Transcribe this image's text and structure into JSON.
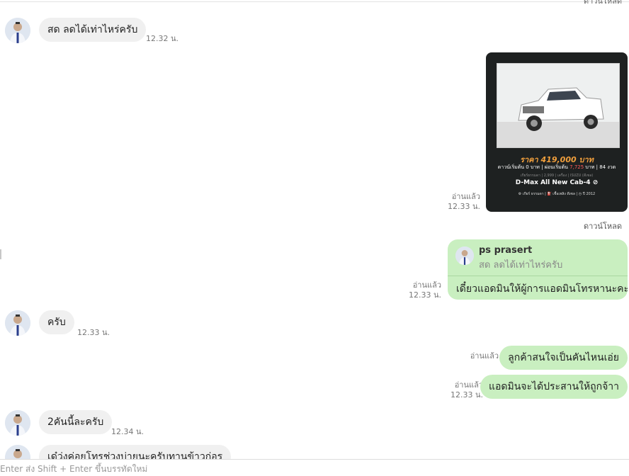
{
  "chat": {
    "download_top": "ดาวน์โหลด",
    "download_label": "ดาวน์โหลด",
    "messages": {
      "m1": {
        "text": "สด ลดได้เท่าไหร่ครับ",
        "time": "12.32 น."
      },
      "img": {
        "read": "อ่านแล้ว",
        "time": "12.33 น."
      },
      "reply": {
        "quoted_name": "ps prasert",
        "quoted_text": "สด ลดได้เท่าไหร่ครับ",
        "text": "เดี๋ยวแอดมินให้ผู้การแอดมินโทรหานะคะ",
        "read": "อ่านแล้ว",
        "time": "12.33 น."
      },
      "m3": {
        "text": "ครับ",
        "time": "12.33 น."
      },
      "m4": {
        "text": "ลูกค้าสนใจเป็นคันไหนเอ่ย",
        "read": "อ่านแล้ว"
      },
      "m5": {
        "text": "แอดมินจะได้ประสานให้ถูกจ้าา",
        "read": "อ่านแล้ว",
        "time": "12.33 น."
      },
      "m6": {
        "text": "2คันนี้ละครับ",
        "time": "12.34 น."
      },
      "m7": {
        "text": "เด๋ว่งค่อยโทรช่วงบ่ายนะครับทานข้าวก่อร"
      }
    }
  },
  "car_card": {
    "price": "ราคา 419,000 บาท",
    "terms_prefix": "ดาวน์เริ่มต้น 0 บาท | ผ่อนเริ่มต้น ",
    "terms_installment": "7,725",
    "terms_suffix": " บาท | 84 งวด",
    "spec": "เกียร์ธรรมดา | 2,999 | เครื่อง | ISUZU (ดีเซล)",
    "model": "D-Max All New Cab-4 ⊘",
    "bottom": "⚙ เกียร์ ธรรมดา  |  ⛽ เชื้อเพลิง ดีเซล  |  ◷ ปี 2012"
  },
  "input": {
    "hint": "Enter ส่ง Shift + Enter ขึ้นบรรทัดใหม่"
  },
  "colors": {
    "incoming": "#f0f0f0",
    "outgoing": "#c9efc0",
    "card_bg": "#1e2121",
    "price": "#f2a03d"
  }
}
